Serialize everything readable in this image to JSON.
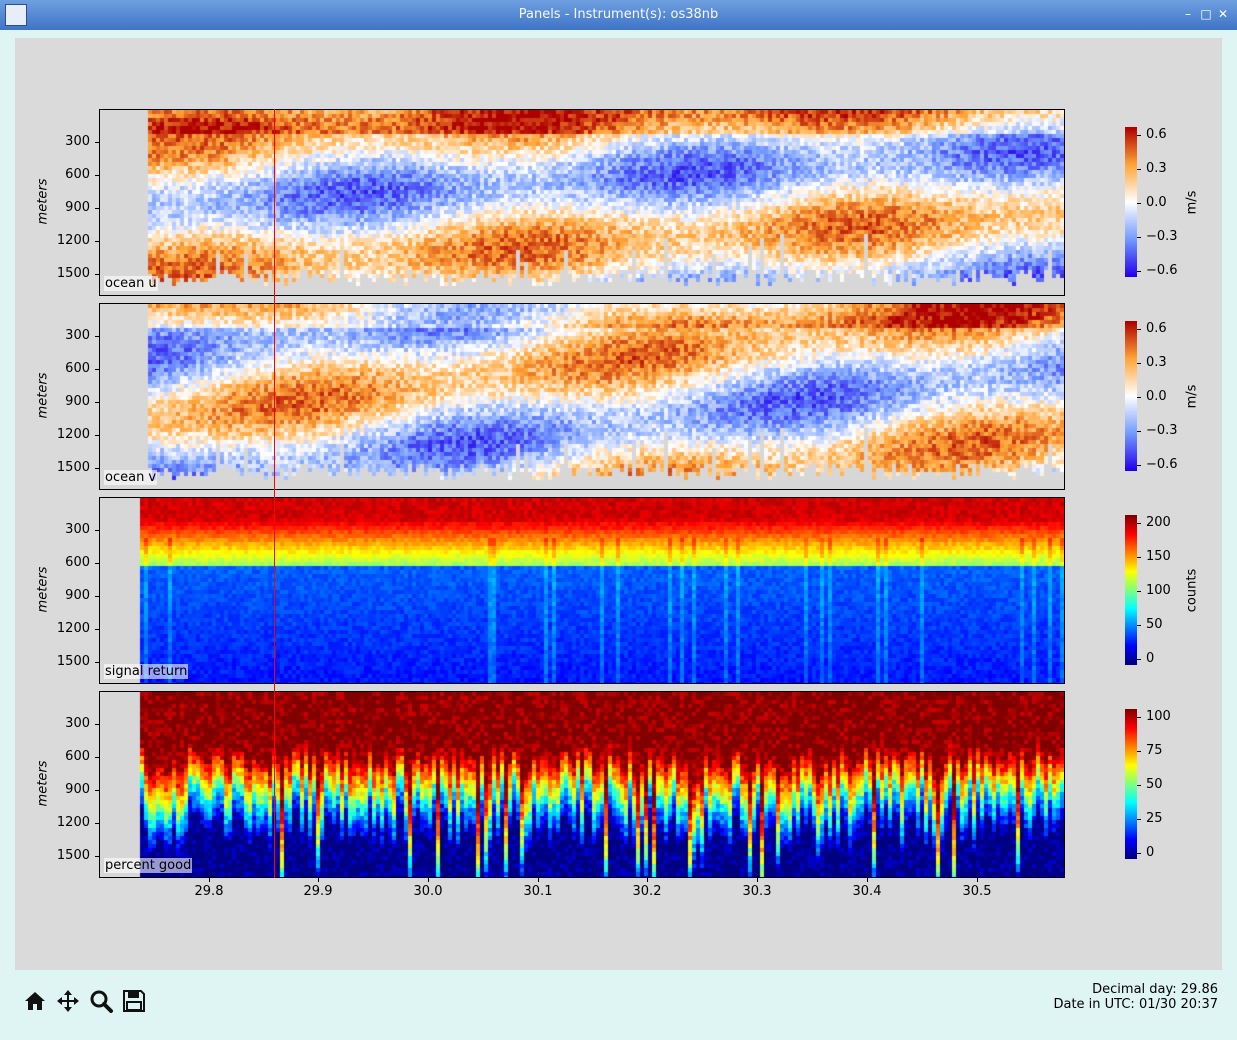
{
  "window": {
    "title": "Panels - Instrument(s): os38nb"
  },
  "panels": [
    {
      "label": "ocean u",
      "ylabel": "meters",
      "unit": "m/s",
      "cmap": "rdbu",
      "yticks": [
        "300",
        "600",
        "900",
        "1200",
        "1500"
      ],
      "cticks": [
        "0.6",
        "0.3",
        "0.0",
        "−0.3",
        "−0.6"
      ]
    },
    {
      "label": "ocean v",
      "ylabel": "meters",
      "unit": "m/s",
      "cmap": "rdbu",
      "yticks": [
        "300",
        "600",
        "900",
        "1200",
        "1500"
      ],
      "cticks": [
        "0.6",
        "0.3",
        "0.0",
        "−0.3",
        "−0.6"
      ]
    },
    {
      "label": "signal return",
      "ylabel": "meters",
      "unit": "counts",
      "cmap": "jet",
      "yticks": [
        "300",
        "600",
        "900",
        "1200",
        "1500"
      ],
      "cticks": [
        "200",
        "150",
        "100",
        "50",
        "0"
      ]
    },
    {
      "label": "percent good",
      "ylabel": "meters",
      "unit": "",
      "cmap": "jet",
      "yticks": [
        "300",
        "600",
        "900",
        "1200",
        "1500"
      ],
      "cticks": [
        "100",
        "75",
        "50",
        "25",
        "0"
      ]
    }
  ],
  "x_axis": {
    "ticks": [
      "29.8",
      "29.9",
      "30.0",
      "30.1",
      "30.2",
      "30.3",
      "30.4",
      "30.5"
    ]
  },
  "status": {
    "decimal_day": "Decimal day: 29.86",
    "date_utc": "Date in UTC: 01/30 20:37"
  },
  "toolbar": {
    "icons": [
      "home-icon",
      "pan-icon",
      "zoom-icon",
      "save-icon"
    ]
  },
  "colors": {
    "cursor": "#ff0000",
    "background": "#dadada",
    "titlebar": "#4a7fd0"
  }
}
